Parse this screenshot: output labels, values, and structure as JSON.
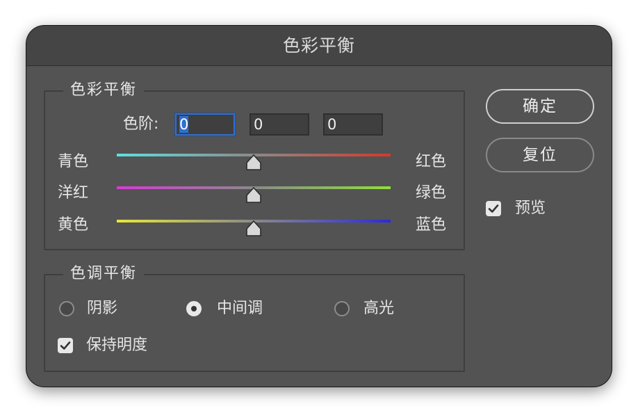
{
  "dialog": {
    "title": "色彩平衡"
  },
  "color_balance": {
    "legend": "色彩平衡",
    "levels_label": "色阶:",
    "levels": [
      "0",
      "0",
      "0"
    ],
    "sliders": [
      {
        "left_label": "青色",
        "right_label": "红色",
        "from_color": "#5fe0e0",
        "to_color": "#d43a2a",
        "value": 0
      },
      {
        "left_label": "洋红",
        "right_label": "绿色",
        "from_color": "#d93ad9",
        "to_color": "#8ee03a",
        "value": 0
      },
      {
        "left_label": "黄色",
        "right_label": "蓝色",
        "from_color": "#e8e83a",
        "to_color": "#2a2ae0",
        "value": 0
      }
    ]
  },
  "tone_balance": {
    "legend": "色调平衡",
    "options": [
      {
        "label": "阴影",
        "selected": false
      },
      {
        "label": "中间调",
        "selected": true
      },
      {
        "label": "高光",
        "selected": false
      }
    ],
    "preserve_luminosity": {
      "label": "保持明度",
      "checked": true
    }
  },
  "buttons": {
    "ok": "确定",
    "reset": "复位"
  },
  "preview": {
    "label": "预览",
    "checked": true
  }
}
